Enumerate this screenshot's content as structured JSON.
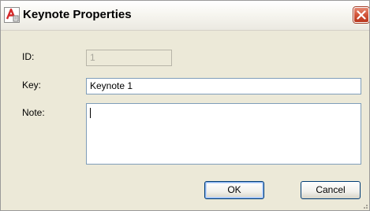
{
  "window": {
    "title": "Keynote Properties",
    "icon": "autocad-app-icon",
    "close_icon": "close-icon"
  },
  "form": {
    "id_label": "ID:",
    "id_value": "1",
    "key_label": "Key:",
    "key_value": "Keynote 1",
    "note_label": "Note:",
    "note_value": ""
  },
  "buttons": {
    "ok_label": "OK",
    "cancel_label": "Cancel"
  },
  "colors": {
    "close_button": "#d2553a",
    "dialog_background": "#ece9d8",
    "input_border": "#7f9db9",
    "icon_accent": "#d42a2a"
  }
}
